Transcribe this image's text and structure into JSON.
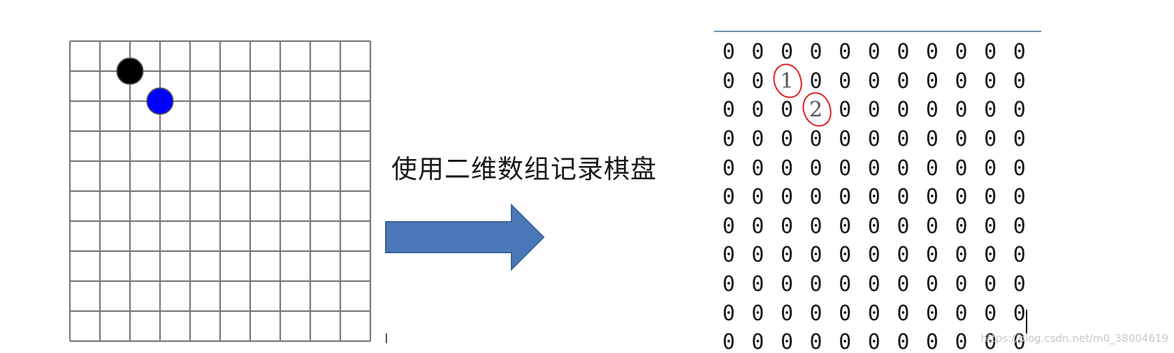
{
  "caption": "使用二维数组记录棋盘",
  "board": {
    "rows": 10,
    "cols": 10,
    "line_color": "#7a7a7a",
    "stones": [
      {
        "row": 1,
        "col": 2,
        "color": "#000000",
        "name": "black-stone"
      },
      {
        "row": 2,
        "col": 3,
        "color": "#0000ff",
        "name": "blue-stone"
      }
    ]
  },
  "matrix": {
    "rows": [
      [
        "0",
        "0",
        "0",
        "0",
        "0",
        "0",
        "0",
        "0",
        "0",
        "0",
        "0"
      ],
      [
        "0",
        "0",
        "1",
        "0",
        "0",
        "0",
        "0",
        "0",
        "0",
        "0",
        "0"
      ],
      [
        "0",
        "0",
        "0",
        "2",
        "0",
        "0",
        "0",
        "0",
        "0",
        "0",
        "0"
      ],
      [
        "0",
        "0",
        "0",
        "0",
        "0",
        "0",
        "0",
        "0",
        "0",
        "0",
        "0"
      ],
      [
        "0",
        "0",
        "0",
        "0",
        "0",
        "0",
        "0",
        "0",
        "0",
        "0",
        "0"
      ],
      [
        "0",
        "0",
        "0",
        "0",
        "0",
        "0",
        "0",
        "0",
        "0",
        "0",
        "0"
      ],
      [
        "0",
        "0",
        "0",
        "0",
        "0",
        "0",
        "0",
        "0",
        "0",
        "0",
        "0"
      ],
      [
        "0",
        "0",
        "0",
        "0",
        "0",
        "0",
        "0",
        "0",
        "0",
        "0",
        "0"
      ],
      [
        "0",
        "0",
        "0",
        "0",
        "0",
        "0",
        "0",
        "0",
        "0",
        "0",
        "0"
      ],
      [
        "0",
        "0",
        "0",
        "0",
        "0",
        "0",
        "0",
        "0",
        "0",
        "0",
        "0"
      ],
      [
        "0",
        "0",
        "0",
        "0",
        "0",
        "0",
        "0",
        "0",
        "0",
        "0",
        "0"
      ]
    ],
    "highlighted": [
      {
        "row": 1,
        "col": 2
      },
      {
        "row": 2,
        "col": 3
      }
    ],
    "highlight_color": "#e02020"
  },
  "arrow": {
    "color": "#4a78b8",
    "stroke": "#3a6398"
  },
  "watermark": "https://blog.csdn.net/m0_38004619"
}
